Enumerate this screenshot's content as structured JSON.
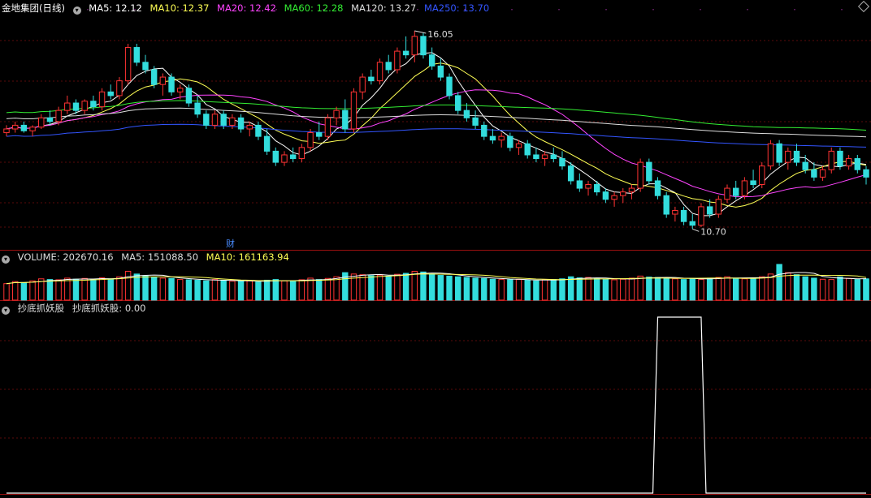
{
  "main_legend": {
    "title": "金地集团(日线)",
    "items": [
      {
        "label": "MA5: 12.12",
        "color": "#ffffff"
      },
      {
        "label": "MA10: 12.37",
        "color": "#ffff55"
      },
      {
        "label": "MA20: 12.42",
        "color": "#ff44ff"
      },
      {
        "label": "MA60: 12.28",
        "color": "#33ee33"
      },
      {
        "label": "MA120: 13.27",
        "color": "#dddddd"
      },
      {
        "label": "MA250: 13.70",
        "color": "#3355ff"
      }
    ]
  },
  "volume_legend": {
    "items": [
      {
        "label": "VOLUME: 202670.16",
        "color": "#dddddd"
      },
      {
        "label": "MA5: 151088.50",
        "color": "#dddddd"
      },
      {
        "label": "MA10: 161163.94",
        "color": "#ffff55"
      }
    ]
  },
  "indicator_legend": {
    "items": [
      {
        "label": "抄底抓妖股",
        "color": "#dddddd"
      },
      {
        "label": "抄底抓妖股: 0.00",
        "color": "#dddddd"
      }
    ]
  },
  "finance_marker": "财",
  "chart_data": [
    {
      "type": "candlestick",
      "title": "金地集团(日线)",
      "price_range": [
        10.4,
        16.4
      ],
      "high_label": "16.05",
      "low_label": "10.70",
      "colors": {
        "up": "#ff3333",
        "down": "#33dddd"
      },
      "ohlc": [
        [
          13.3,
          13.5,
          13.2,
          13.4
        ],
        [
          13.4,
          13.6,
          13.3,
          13.5
        ],
        [
          13.5,
          13.6,
          13.3,
          13.35
        ],
        [
          13.35,
          13.5,
          13.2,
          13.45
        ],
        [
          13.45,
          13.8,
          13.4,
          13.7
        ],
        [
          13.7,
          13.9,
          13.5,
          13.6
        ],
        [
          13.6,
          14.0,
          13.5,
          13.9
        ],
        [
          13.9,
          14.3,
          13.8,
          14.1
        ],
        [
          14.1,
          14.2,
          13.8,
          13.9
        ],
        [
          13.9,
          14.2,
          13.8,
          14.15
        ],
        [
          14.15,
          14.3,
          13.9,
          14.0
        ],
        [
          14.0,
          14.5,
          13.9,
          14.4
        ],
        [
          14.4,
          14.6,
          14.2,
          14.3
        ],
        [
          14.3,
          14.8,
          14.2,
          14.7
        ],
        [
          14.7,
          15.7,
          14.6,
          15.6
        ],
        [
          15.6,
          15.7,
          15.1,
          15.2
        ],
        [
          15.2,
          15.4,
          14.9,
          15.0
        ],
        [
          15.0,
          15.1,
          14.5,
          14.6
        ],
        [
          14.6,
          14.9,
          14.3,
          14.8
        ],
        [
          14.8,
          14.9,
          14.3,
          14.4
        ],
        [
          14.4,
          14.6,
          14.2,
          14.5
        ],
        [
          14.5,
          14.6,
          14.0,
          14.1
        ],
        [
          14.1,
          14.3,
          13.7,
          13.8
        ],
        [
          13.8,
          13.9,
          13.4,
          13.5
        ],
        [
          13.5,
          13.9,
          13.4,
          13.8
        ],
        [
          13.8,
          13.9,
          13.4,
          13.5
        ],
        [
          13.5,
          13.8,
          13.4,
          13.7
        ],
        [
          13.7,
          13.8,
          13.3,
          13.4
        ],
        [
          13.4,
          13.6,
          13.2,
          13.5
        ],
        [
          13.5,
          13.6,
          13.1,
          13.2
        ],
        [
          13.2,
          13.4,
          12.7,
          12.8
        ],
        [
          12.8,
          12.9,
          12.4,
          12.5
        ],
        [
          12.5,
          12.8,
          12.4,
          12.7
        ],
        [
          12.7,
          12.9,
          12.5,
          12.6
        ],
        [
          12.6,
          13.0,
          12.5,
          12.9
        ],
        [
          12.9,
          13.4,
          12.8,
          13.3
        ],
        [
          13.3,
          13.6,
          13.1,
          13.2
        ],
        [
          13.2,
          13.8,
          13.1,
          13.7
        ],
        [
          13.7,
          14.0,
          13.5,
          13.9
        ],
        [
          13.9,
          14.2,
          13.3,
          13.4
        ],
        [
          13.4,
          14.5,
          13.3,
          14.4
        ],
        [
          14.4,
          14.9,
          14.2,
          14.8
        ],
        [
          14.8,
          15.0,
          14.6,
          14.7
        ],
        [
          14.7,
          15.3,
          14.6,
          15.2
        ],
        [
          15.2,
          15.4,
          14.9,
          15.0
        ],
        [
          15.0,
          15.6,
          14.9,
          15.5
        ],
        [
          15.5,
          15.9,
          15.3,
          15.4
        ],
        [
          15.4,
          16.05,
          15.2,
          15.9
        ],
        [
          15.9,
          16.0,
          15.3,
          15.4
        ],
        [
          15.4,
          15.6,
          15.0,
          15.1
        ],
        [
          15.1,
          15.3,
          14.7,
          14.8
        ],
        [
          14.8,
          14.9,
          14.2,
          14.3
        ],
        [
          14.3,
          14.4,
          13.8,
          13.9
        ],
        [
          13.9,
          14.1,
          13.6,
          13.7
        ],
        [
          13.7,
          13.9,
          13.4,
          13.5
        ],
        [
          13.5,
          13.6,
          13.1,
          13.2
        ],
        [
          13.2,
          13.4,
          13.0,
          13.1
        ],
        [
          13.1,
          13.3,
          12.9,
          13.2
        ],
        [
          13.2,
          13.3,
          12.8,
          12.9
        ],
        [
          12.9,
          13.1,
          12.7,
          13.0
        ],
        [
          13.0,
          13.1,
          12.6,
          12.7
        ],
        [
          12.7,
          12.9,
          12.5,
          12.6
        ],
        [
          12.6,
          12.8,
          12.4,
          12.7
        ],
        [
          12.7,
          12.9,
          12.5,
          12.6
        ],
        [
          12.6,
          12.8,
          12.3,
          12.4
        ],
        [
          12.4,
          12.5,
          11.9,
          12.0
        ],
        [
          12.0,
          12.2,
          11.7,
          11.8
        ],
        [
          11.8,
          12.0,
          11.6,
          11.9
        ],
        [
          11.9,
          12.0,
          11.6,
          11.7
        ],
        [
          11.7,
          11.8,
          11.4,
          11.5
        ],
        [
          11.5,
          11.7,
          11.3,
          11.6
        ],
        [
          11.6,
          11.8,
          11.4,
          11.7
        ],
        [
          11.7,
          11.9,
          11.5,
          11.8
        ],
        [
          11.8,
          12.6,
          11.7,
          12.5
        ],
        [
          12.5,
          12.6,
          11.9,
          12.0
        ],
        [
          12.0,
          12.1,
          11.5,
          11.6
        ],
        [
          11.6,
          11.7,
          11.0,
          11.1
        ],
        [
          11.1,
          11.3,
          10.9,
          11.2
        ],
        [
          11.2,
          11.3,
          10.8,
          10.9
        ],
        [
          10.9,
          11.1,
          10.7,
          10.8
        ],
        [
          10.8,
          11.4,
          10.75,
          11.3
        ],
        [
          11.3,
          11.5,
          11.0,
          11.1
        ],
        [
          11.1,
          11.6,
          11.0,
          11.5
        ],
        [
          11.5,
          11.9,
          11.4,
          11.8
        ],
        [
          11.8,
          12.0,
          11.5,
          11.6
        ],
        [
          11.6,
          12.1,
          11.5,
          12.0
        ],
        [
          12.0,
          12.3,
          11.8,
          11.9
        ],
        [
          11.9,
          12.5,
          11.8,
          12.4
        ],
        [
          12.4,
          13.1,
          12.3,
          13.0
        ],
        [
          13.0,
          13.1,
          12.4,
          12.5
        ],
        [
          12.5,
          12.9,
          12.3,
          12.8
        ],
        [
          12.8,
          13.0,
          12.4,
          12.5
        ],
        [
          12.5,
          12.7,
          12.2,
          12.3
        ],
        [
          12.3,
          12.5,
          12.0,
          12.1
        ],
        [
          12.1,
          12.4,
          12.0,
          12.3
        ],
        [
          12.3,
          12.9,
          12.2,
          12.8
        ],
        [
          12.8,
          12.9,
          12.3,
          12.4
        ],
        [
          12.4,
          12.7,
          12.3,
          12.6
        ],
        [
          12.6,
          12.7,
          12.2,
          12.3
        ],
        [
          12.3,
          12.4,
          11.9,
          12.1
        ]
      ]
    },
    {
      "type": "bar",
      "title": "VOLUME",
      "values": [
        120,
        135,
        128,
        140,
        155,
        150,
        148,
        160,
        152,
        158,
        150,
        162,
        155,
        170,
        210,
        190,
        175,
        168,
        160,
        158,
        150,
        148,
        145,
        140,
        150,
        142,
        138,
        136,
        140,
        132,
        145,
        150,
        140,
        138,
        148,
        160,
        150,
        158,
        170,
        200,
        190,
        185,
        178,
        182,
        175,
        188,
        195,
        210,
        205,
        190,
        180,
        175,
        170,
        165,
        160,
        158,
        152,
        150,
        148,
        150,
        145,
        140,
        148,
        150,
        155,
        170,
        162,
        165,
        158,
        150,
        148,
        152,
        160,
        175,
        168,
        165,
        160,
        155,
        150,
        158,
        150,
        160,
        165,
        170,
        160,
        155,
        162,
        170,
        190,
        260,
        200,
        185,
        170,
        160,
        152,
        150,
        168,
        158,
        150,
        155,
        148
      ],
      "ma5": 151088.5,
      "ma10": 161163.94
    },
    {
      "type": "line",
      "title": "抄底抓妖股",
      "signal_window": {
        "start_index": 75,
        "end_index": 80
      },
      "value_range": [
        0,
        1
      ]
    }
  ]
}
